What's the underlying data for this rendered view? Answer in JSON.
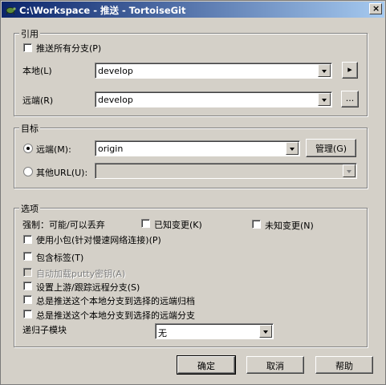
{
  "window": {
    "title": "C:\\Workspace - 推送 - TortoiseGit",
    "icon": "tortoise-icon",
    "close_glyph": "×"
  },
  "ref_group": {
    "label": "引用",
    "push_all_branches": {
      "text": "推送所有分支",
      "accel": "(P)",
      "checked": false
    },
    "local_label": "本地(L)",
    "local_value": "develop",
    "remote_label": "远端(R)",
    "remote_value": "develop",
    "arrow_button": "▸",
    "browse_button": "..."
  },
  "target_group": {
    "label": "目标",
    "remote_radio": {
      "text": "远端(M):",
      "selected": true
    },
    "remote_value": "origin",
    "manage_button": "管理(G)",
    "other_url_radio": {
      "text": "其他URL(U):",
      "selected": false
    },
    "other_url_value": ""
  },
  "options_group": {
    "label": "选项",
    "force_label": "强制：可能/可以丢弃",
    "known_changes": "已知变更(K)",
    "unknown_changes": "未知变更(N)",
    "thin_pack": "使用小包(针对慢速网络连接)(P)",
    "include_tags": "包含标签(T)",
    "autoload_putty": "自动加载putty密钥(A)",
    "set_upstream": "设置上游/跟踪远程分支(S)",
    "always_push_archive": "总是推送这个本地分支到选择的远端归档",
    "always_push_branch": "总是推送这个本地分支到选择的远端分支",
    "recurse_submodules_label": "递归子模块",
    "recurse_submodules_value": "无"
  },
  "buttons": {
    "ok": "确定",
    "cancel": "取消",
    "help": "帮助"
  }
}
